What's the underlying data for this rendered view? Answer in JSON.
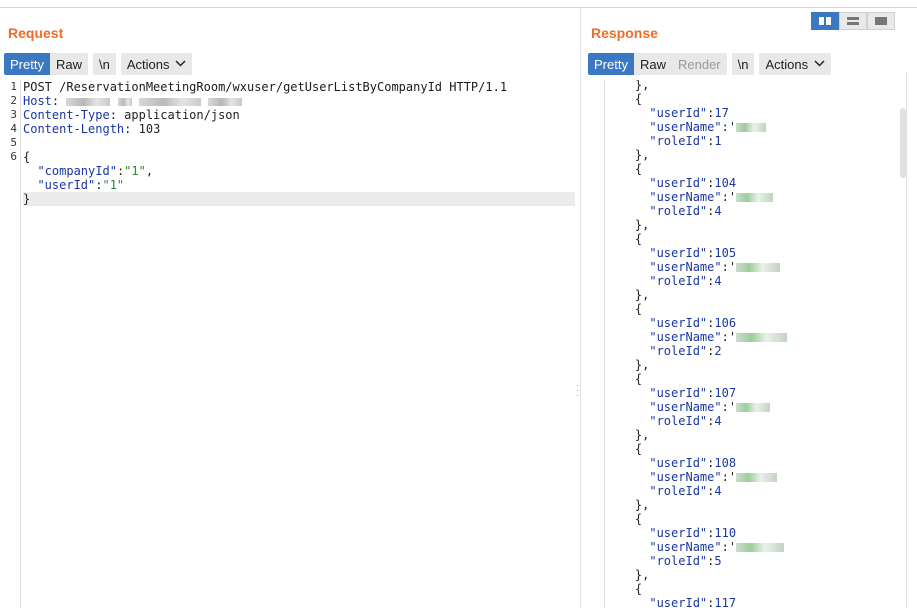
{
  "request": {
    "title": "Request",
    "tabs": {
      "pretty": "Pretty",
      "raw": "Raw",
      "newline": "\\n",
      "actions": "Actions"
    },
    "line_numbers": [
      "1",
      "2",
      "3",
      "4",
      "5",
      "6",
      "",
      "",
      ""
    ],
    "lines": {
      "l1": "POST /ReservationMeetingRoom/wxuser/getUserListByCompanyId HTTP/1.1",
      "l2_key": "Host",
      "l3_key": "Content-Type",
      "l3_val": " application/json",
      "l4_key": "Content-Length",
      "l4_val": " 103",
      "l6": "{",
      "l7_key": "\"companyId\"",
      "l7_val": "\"1\"",
      "l8_key": "\"userId\"",
      "l8_val": "\"1\"",
      "l9": "}"
    }
  },
  "response": {
    "title": "Response",
    "tabs": {
      "pretty": "Pretty",
      "raw": "Raw",
      "render": "Render",
      "newline": "\\n",
      "actions": "Actions"
    },
    "keys": {
      "userId": "\"userId\"",
      "userName": "\"userName\"",
      "roleId": "\"roleId\""
    },
    "records": [
      {
        "userId": "17",
        "roleId": "1"
      },
      {
        "userId": "104",
        "roleId": "4"
      },
      {
        "userId": "105",
        "roleId": "4"
      },
      {
        "userId": "106",
        "roleId": "2"
      },
      {
        "userId": "107",
        "roleId": "4"
      },
      {
        "userId": "108",
        "roleId": "4"
      },
      {
        "userId": "110",
        "roleId": "5"
      },
      {
        "userId": "117",
        "roleId": ""
      }
    ]
  },
  "colors": {
    "accent": "#ef6b28",
    "active_tab": "#3b78c4",
    "key": "#1a36a3",
    "string": "#2b8a2b"
  },
  "icons": [
    "split-horizontal-icon",
    "split-vertical-icon",
    "single-pane-icon",
    "chevron-down-icon",
    "drag-handle-icon"
  ]
}
